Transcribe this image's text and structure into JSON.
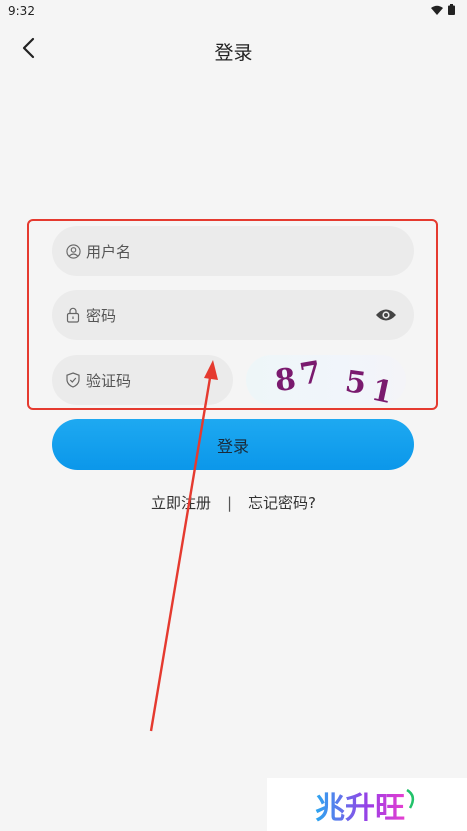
{
  "status_bar": {
    "time": "9:32",
    "icons": [
      "wifi-icon",
      "battery-icon"
    ]
  },
  "header": {
    "title": "登录",
    "back_icon": "chevron-left-icon"
  },
  "form": {
    "username": {
      "placeholder": "用户名",
      "icon": "user-icon"
    },
    "password": {
      "placeholder": "密码",
      "icon": "lock-icon",
      "toggle_icon": "eye-icon"
    },
    "captcha": {
      "placeholder": "验证码",
      "icon": "shield-icon",
      "code": "8751"
    }
  },
  "login_button": "登录",
  "links": {
    "register": "立即注册",
    "separator": "|",
    "forgot": "忘记密码?"
  },
  "watermark": "兆升旺",
  "colors": {
    "accent": "#0b97ea",
    "highlight": "#e53a2f",
    "captcha_text": "#7a1a6e"
  }
}
